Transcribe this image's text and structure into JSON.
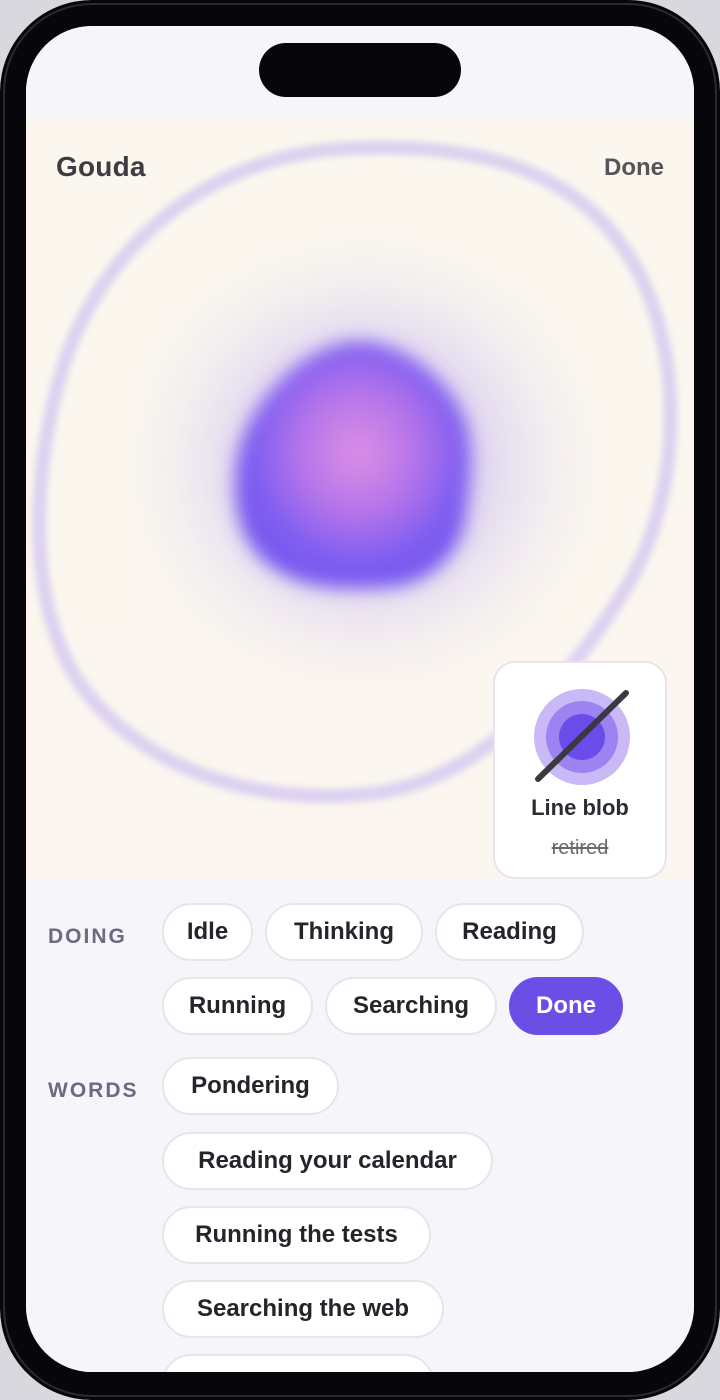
{
  "header": {
    "title": "Gouda",
    "done_label": "Done"
  },
  "style_card": {
    "title": "Line blob",
    "status": "retired",
    "icon": "line-blob-icon"
  },
  "doing": {
    "label": "DOING",
    "chips": [
      "Idle",
      "Thinking",
      "Reading",
      "Running",
      "Searching",
      "Done"
    ],
    "selected": "Done"
  },
  "words": {
    "label": "WORDS",
    "chips": [
      "Pondering",
      "Reading your calendar",
      "Running the tests",
      "Searching the web"
    ]
  },
  "colors": {
    "accent": "#6b4ee6",
    "blob": "#7b5cf0",
    "blob_core": "#d98be3",
    "ring": "#cfc4ef",
    "background": "#fbf7ee"
  }
}
